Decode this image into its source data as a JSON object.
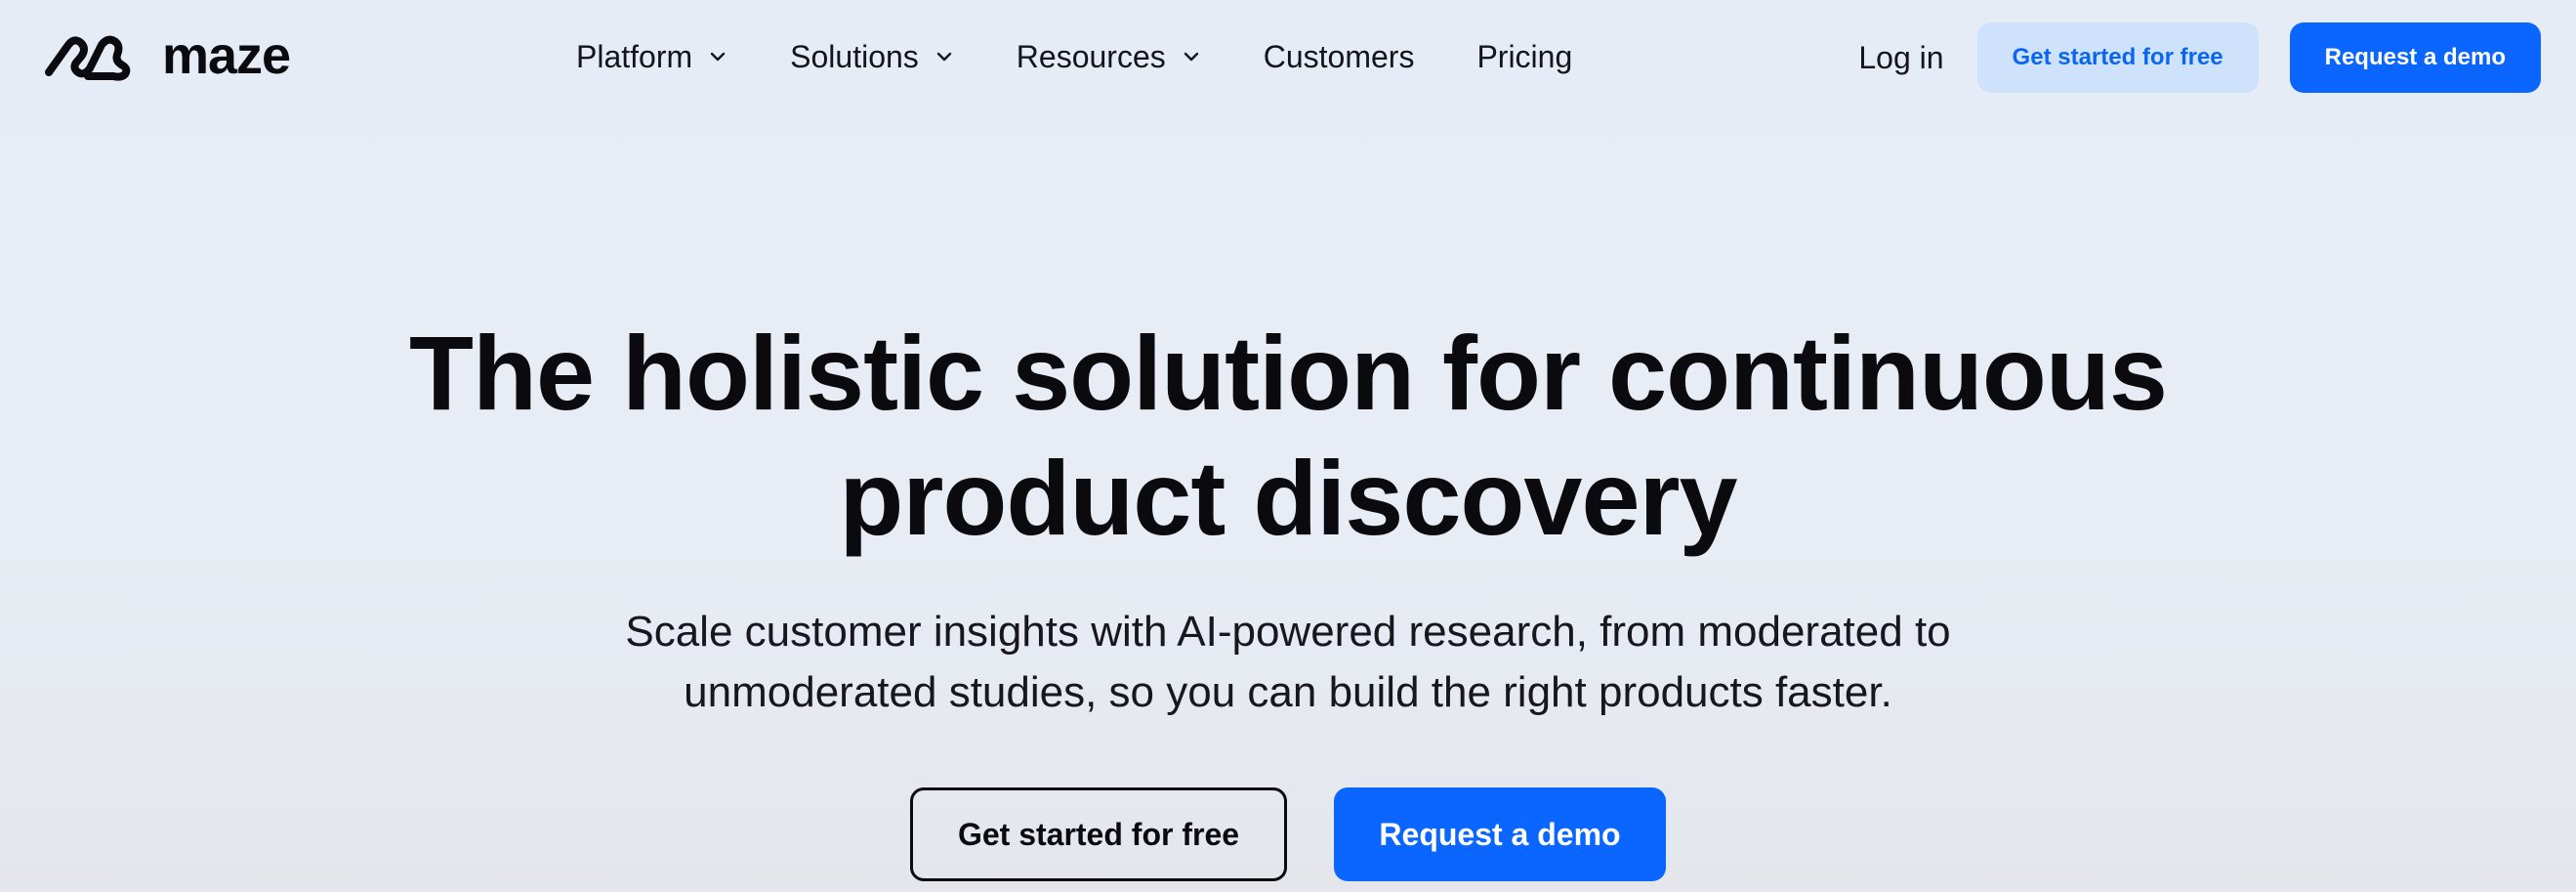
{
  "brand": {
    "name": "maze",
    "logo_icon": "maze-logo-icon"
  },
  "nav": {
    "items": [
      {
        "label": "Platform",
        "has_dropdown": true
      },
      {
        "label": "Solutions",
        "has_dropdown": true
      },
      {
        "label": "Resources",
        "has_dropdown": true
      },
      {
        "label": "Customers",
        "has_dropdown": false
      },
      {
        "label": "Pricing",
        "has_dropdown": false
      }
    ],
    "login_label": "Log in",
    "get_started_label": "Get started for free",
    "request_demo_label": "Request a demo"
  },
  "hero": {
    "headline_line1": "The holistic solution for continuous",
    "headline_line2": "product discovery",
    "subhead_line1": "Scale customer insights with AI-powered research, from moderated to",
    "subhead_line2": "unmoderated studies, so you can build the right products faster.",
    "cta_primary": "Get started for free",
    "cta_secondary": "Request a demo"
  },
  "colors": {
    "accent": "#0a66ff",
    "accent_light": "#cfe2fb",
    "text": "#0b0b0f"
  }
}
